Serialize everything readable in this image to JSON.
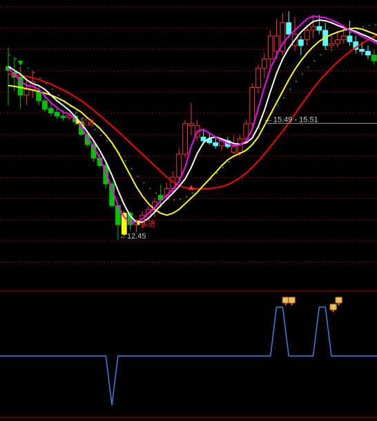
{
  "chart_data": [
    {
      "type": "candlestick",
      "title": "",
      "ylim": [
        11.4,
        18.6
      ],
      "colors": {
        "up": "#FF3232",
        "down_main": "#00C000",
        "down_alt": "#54FFFF",
        "limit_up": "#FFFF00",
        "ma_white": "#FFFFFF",
        "ma_magenta": "#FF00FF",
        "ma_yellow": "#FFFF00",
        "ma_red": "#FF0000",
        "dots": "#00C000",
        "grid": "#8B0000"
      },
      "candles": [
        {
          "o": 17.0,
          "h": 17.5,
          "l": 15.98,
          "c": 16.9,
          "k": "down_main"
        },
        {
          "o": 16.85,
          "h": 17.25,
          "l": 16.35,
          "c": 16.72,
          "k": "down_main"
        },
        {
          "o": 16.72,
          "h": 17.0,
          "l": 15.9,
          "c": 16.25,
          "k": "down_main"
        },
        {
          "o": 16.25,
          "h": 16.62,
          "l": 16.0,
          "c": 16.4,
          "k": "up"
        },
        {
          "o": 16.4,
          "h": 16.9,
          "l": 16.18,
          "c": 16.6,
          "k": "up"
        },
        {
          "o": 16.35,
          "h": 16.52,
          "l": 15.98,
          "c": 16.1,
          "k": "down_main"
        },
        {
          "o": 16.1,
          "h": 16.3,
          "l": 15.82,
          "c": 15.88,
          "k": "down_main"
        },
        {
          "o": 15.9,
          "h": 16.05,
          "l": 15.7,
          "c": 15.78,
          "k": "down_main"
        },
        {
          "o": 15.8,
          "h": 15.95,
          "l": 15.62,
          "c": 15.7,
          "k": "down_main"
        },
        {
          "o": 15.7,
          "h": 15.85,
          "l": 15.58,
          "c": 15.66,
          "k": "down_main"
        },
        {
          "o": 15.66,
          "h": 15.78,
          "l": 15.58,
          "c": 15.72,
          "k": "up"
        },
        {
          "o": 15.7,
          "h": 15.8,
          "l": 15.45,
          "c": 15.55,
          "k": "down_main"
        },
        {
          "o": 15.55,
          "h": 15.65,
          "l": 15.18,
          "c": 15.22,
          "k": "down_main"
        },
        {
          "o": 15.22,
          "h": 15.3,
          "l": 14.9,
          "c": 14.95,
          "k": "down_main"
        },
        {
          "o": 14.95,
          "h": 15.05,
          "l": 14.5,
          "c": 14.6,
          "k": "down_main"
        },
        {
          "o": 14.6,
          "h": 14.7,
          "l": 14.35,
          "c": 14.4,
          "k": "down_main"
        },
        {
          "o": 14.4,
          "h": 14.5,
          "l": 13.8,
          "c": 13.92,
          "k": "down_main"
        },
        {
          "o": 13.92,
          "h": 14.0,
          "l": 13.3,
          "c": 13.35,
          "k": "down_main"
        },
        {
          "o": 13.35,
          "h": 13.4,
          "l": 12.45,
          "c": 12.85,
          "k": "down_main"
        },
        {
          "o": 12.6,
          "h": 13.2,
          "l": 12.55,
          "c": 13.15,
          "k": "limit_up"
        },
        {
          "o": 13.15,
          "h": 13.2,
          "l": 12.7,
          "c": 12.85,
          "k": "down_main"
        },
        {
          "o": 12.85,
          "h": 13.0,
          "l": 12.65,
          "c": 12.95,
          "k": "up"
        },
        {
          "o": 12.9,
          "h": 13.2,
          "l": 12.75,
          "c": 13.1,
          "k": "up"
        },
        {
          "o": 13.05,
          "h": 13.35,
          "l": 12.95,
          "c": 13.25,
          "k": "up"
        },
        {
          "o": 13.2,
          "h": 13.55,
          "l": 13.05,
          "c": 13.45,
          "k": "up"
        },
        {
          "o": 13.5,
          "h": 13.9,
          "l": 13.3,
          "c": 13.62,
          "k": "down_main"
        },
        {
          "o": 13.6,
          "h": 13.95,
          "l": 13.5,
          "c": 13.8,
          "k": "up"
        },
        {
          "o": 13.8,
          "h": 14.25,
          "l": 13.7,
          "c": 14.1,
          "k": "up"
        },
        {
          "o": 14.1,
          "h": 14.85,
          "l": 14.0,
          "c": 14.7,
          "k": "up"
        },
        {
          "o": 14.7,
          "h": 15.6,
          "l": 14.6,
          "c": 15.5,
          "k": "up"
        },
        {
          "o": 15.5,
          "h": 16.05,
          "l": 15.2,
          "c": 15.45,
          "k": "up"
        },
        {
          "o": 15.45,
          "h": 15.6,
          "l": 15.05,
          "c": 15.15,
          "k": "up"
        },
        {
          "o": 15.15,
          "h": 15.35,
          "l": 14.95,
          "c": 15.05,
          "k": "down_alt"
        },
        {
          "o": 15.1,
          "h": 15.25,
          "l": 14.95,
          "c": 15.0,
          "k": "down_alt"
        },
        {
          "o": 15.0,
          "h": 15.15,
          "l": 14.85,
          "c": 14.92,
          "k": "down_alt"
        },
        {
          "o": 14.92,
          "h": 15.1,
          "l": 14.8,
          "c": 15.05,
          "k": "up"
        },
        {
          "o": 15.05,
          "h": 15.15,
          "l": 14.85,
          "c": 14.9,
          "k": "down_alt"
        },
        {
          "o": 14.9,
          "h": 15.2,
          "l": 14.7,
          "c": 14.75,
          "k": "up"
        },
        {
          "o": 14.75,
          "h": 15.2,
          "l": 14.65,
          "c": 15.1,
          "k": "up"
        },
        {
          "o": 15.1,
          "h": 15.6,
          "l": 15.0,
          "c": 15.5,
          "k": "up"
        },
        {
          "o": 15.5,
          "h": 16.55,
          "l": 15.4,
          "c": 16.45,
          "k": "up"
        },
        {
          "o": 16.45,
          "h": 17.05,
          "l": 16.3,
          "c": 16.95,
          "k": "up"
        },
        {
          "o": 16.95,
          "h": 17.35,
          "l": 16.7,
          "c": 17.2,
          "k": "up"
        },
        {
          "o": 17.2,
          "h": 17.95,
          "l": 17.0,
          "c": 17.8,
          "k": "up"
        },
        {
          "o": 17.8,
          "h": 18.25,
          "l": 17.2,
          "c": 17.4,
          "k": "up"
        },
        {
          "o": 17.4,
          "h": 18.4,
          "l": 17.3,
          "c": 18.15,
          "k": "up"
        },
        {
          "o": 18.15,
          "h": 18.45,
          "l": 17.75,
          "c": 17.85,
          "k": "down_alt"
        },
        {
          "o": 17.85,
          "h": 18.3,
          "l": 17.4,
          "c": 17.55,
          "k": "up"
        },
        {
          "o": 17.55,
          "h": 17.8,
          "l": 17.3,
          "c": 17.7,
          "k": "down_alt"
        },
        {
          "o": 17.7,
          "h": 18.1,
          "l": 17.55,
          "c": 17.95,
          "k": "up"
        },
        {
          "o": 17.95,
          "h": 18.35,
          "l": 17.75,
          "c": 18.05,
          "k": "up"
        },
        {
          "o": 18.05,
          "h": 18.35,
          "l": 17.85,
          "c": 17.95,
          "k": "down_alt"
        },
        {
          "o": 17.95,
          "h": 18.15,
          "l": 17.45,
          "c": 17.55,
          "k": "down_alt"
        },
        {
          "o": 17.55,
          "h": 17.85,
          "l": 17.4,
          "c": 17.6,
          "k": "up"
        },
        {
          "o": 17.6,
          "h": 17.95,
          "l": 17.5,
          "c": 17.7,
          "k": "up"
        },
        {
          "o": 17.7,
          "h": 18.1,
          "l": 17.6,
          "c": 17.8,
          "k": "up"
        },
        {
          "o": 17.8,
          "h": 18.2,
          "l": 17.55,
          "c": 17.65,
          "k": "down_alt"
        },
        {
          "o": 17.65,
          "h": 17.8,
          "l": 17.35,
          "c": 17.45,
          "k": "down_alt"
        },
        {
          "o": 17.45,
          "h": 17.65,
          "l": 17.3,
          "c": 17.4,
          "k": "down_alt"
        },
        {
          "o": 17.4,
          "h": 17.55,
          "l": 17.2,
          "c": 17.3,
          "k": "down_alt"
        },
        {
          "o": 17.3,
          "h": 17.45,
          "l": 17.05,
          "c": 17.15,
          "k": "down_main"
        },
        {
          "o": 17.15,
          "h": 17.3,
          "l": 16.95,
          "c": 17.05,
          "k": "down_main"
        },
        {
          "o": 17.05,
          "h": 17.2,
          "l": 16.9,
          "c": 17.0,
          "k": "down_main"
        }
      ],
      "series": [
        {
          "id": "white",
          "values": [
            17.0,
            16.9,
            16.8,
            16.65,
            16.55,
            16.5,
            16.4,
            16.25,
            16.1,
            15.98,
            15.85,
            15.68,
            15.5,
            15.28,
            15.05,
            14.8,
            14.5,
            14.15,
            13.75,
            13.38,
            13.08,
            12.92,
            12.92,
            13.02,
            13.18,
            13.36,
            13.52,
            13.68,
            13.85,
            14.05,
            14.35,
            14.72,
            15.0,
            15.12,
            15.15,
            15.1,
            15.04,
            14.98,
            14.96,
            15.0,
            15.12,
            15.42,
            15.85,
            16.35,
            16.82,
            17.2,
            17.48,
            17.7,
            17.9,
            18.05,
            18.18,
            18.22,
            18.2,
            18.15,
            18.08,
            18.02,
            17.97,
            17.92,
            17.85,
            17.78,
            17.7,
            17.62,
            17.55
          ]
        },
        {
          "id": "magenta",
          "values": [
            16.95,
            16.8,
            16.62,
            16.5,
            16.48,
            16.4,
            16.22,
            16.05,
            15.92,
            15.8,
            15.76,
            15.62,
            15.4,
            15.15,
            14.9,
            14.6,
            14.22,
            13.8,
            13.35,
            13.05,
            12.9,
            12.92,
            13.0,
            13.15,
            13.3,
            13.48,
            13.62,
            13.78,
            13.98,
            14.35,
            14.9,
            15.3,
            15.35,
            15.25,
            15.15,
            15.05,
            14.98,
            14.92,
            14.95,
            15.05,
            15.35,
            15.9,
            16.45,
            16.95,
            17.3,
            17.6,
            17.8,
            17.95,
            18.1,
            18.25,
            18.32,
            18.3,
            18.28,
            18.22,
            18.15,
            18.05,
            17.95,
            17.88,
            17.8,
            17.72,
            17.65,
            17.55,
            17.45
          ]
        },
        {
          "id": "yellow",
          "values": [
            16.5,
            16.48,
            16.45,
            16.42,
            16.38,
            16.35,
            16.3,
            16.25,
            16.18,
            16.1,
            16.0,
            15.9,
            15.8,
            15.65,
            15.52,
            15.38,
            15.2,
            15.0,
            14.75,
            14.45,
            14.15,
            13.85,
            13.6,
            13.4,
            13.25,
            13.15,
            13.1,
            13.15,
            13.25,
            13.4,
            13.55,
            13.7,
            13.88,
            14.05,
            14.22,
            14.4,
            14.55,
            14.65,
            14.72,
            14.8,
            14.95,
            15.15,
            15.45,
            15.75,
            16.05,
            16.35,
            16.65,
            16.92,
            17.15,
            17.35,
            17.52,
            17.66,
            17.76,
            17.84,
            17.9,
            17.95,
            17.99,
            18.01,
            17.98,
            17.92,
            17.86,
            17.8,
            17.72
          ]
        },
        {
          "id": "red",
          "values": [
            16.8,
            16.78,
            16.76,
            16.74,
            16.7,
            16.66,
            16.6,
            16.54,
            16.46,
            16.38,
            16.3,
            16.2,
            16.1,
            15.98,
            15.85,
            15.72,
            15.58,
            15.44,
            15.3,
            15.15,
            15.0,
            14.85,
            14.7,
            14.55,
            14.4,
            14.25,
            14.1,
            13.98,
            13.88,
            13.82,
            13.8,
            13.79,
            13.79,
            13.8,
            13.82,
            13.85,
            13.9,
            13.98,
            14.08,
            14.2,
            14.35,
            14.52,
            14.7,
            14.9,
            15.1,
            15.3,
            15.52,
            15.75,
            15.98,
            16.2,
            16.42,
            16.62,
            16.8,
            16.96,
            17.12,
            17.26,
            17.38,
            17.5,
            17.6,
            17.7,
            17.78,
            17.86,
            17.92
          ]
        },
        {
          "id": "dots",
          "values": [
            17.3,
            17.2,
            17.08,
            16.96,
            16.84,
            16.7,
            16.55,
            16.4,
            16.25,
            16.1,
            15.95,
            15.8,
            15.65,
            15.5,
            15.35,
            15.2,
            15.05,
            14.9,
            14.72,
            14.52,
            14.32,
            14.12,
            13.95,
            13.8,
            13.68,
            13.58,
            13.52,
            13.5,
            13.52,
            13.58,
            13.68,
            13.8,
            13.92,
            14.05,
            14.2,
            14.35,
            14.5,
            14.66,
            14.82,
            15.0,
            15.18,
            15.38,
            15.58,
            15.78,
            15.98,
            16.18,
            16.4,
            16.6,
            16.8,
            16.98,
            17.15,
            17.3,
            17.45,
            17.58,
            17.7,
            17.8,
            17.9,
            17.98,
            18.04,
            18.08,
            18.1,
            18.1,
            18.1
          ]
        }
      ],
      "reference_line": {
        "value": 15.51
      },
      "annotations": [
        {
          "text": "←12.45",
          "index": 18,
          "price": 12.45
        },
        {
          "text": "←15.49 - 15.51",
          "index": 42,
          "price": 15.51
        },
        {
          "text": "买进",
          "index": 11,
          "price": 15.55
        },
        {
          "text": "买进",
          "index": 21,
          "price": 12.9
        }
      ],
      "markers": [
        {
          "shape": "triangle-down",
          "color": "#00C000",
          "index": 2,
          "price": 17.1
        },
        {
          "shape": "triangle-up",
          "color": "#FF3232",
          "index": 30,
          "price": 13.82
        }
      ]
    },
    {
      "type": "line",
      "title": "",
      "ylim": [
        -1.2,
        1.2
      ],
      "values": [
        0,
        0,
        0,
        0,
        0,
        0,
        0,
        0,
        0,
        0,
        0,
        0,
        0,
        0,
        0,
        0,
        0,
        0,
        0,
        -1,
        0,
        0,
        0,
        0,
        0,
        0,
        0,
        0,
        0,
        0,
        0,
        0,
        0,
        0,
        0,
        0,
        0,
        0,
        0,
        0,
        0,
        0,
        0,
        0,
        0,
        0,
        1,
        1,
        0,
        0,
        0,
        0,
        0,
        1,
        1,
        0,
        0,
        0,
        0,
        0,
        0,
        0,
        0,
        0,
        0,
        0,
        0,
        0,
        0,
        0,
        0
      ],
      "color": "#3C82E6",
      "icons": [
        {
          "name": "signal-icon",
          "index": 45.5
        },
        {
          "name": "signal-icon",
          "index": 46.5
        },
        {
          "name": "signal-icon",
          "index": 54.2
        },
        {
          "name": "signal-icon",
          "index": 53.3
        }
      ]
    }
  ]
}
